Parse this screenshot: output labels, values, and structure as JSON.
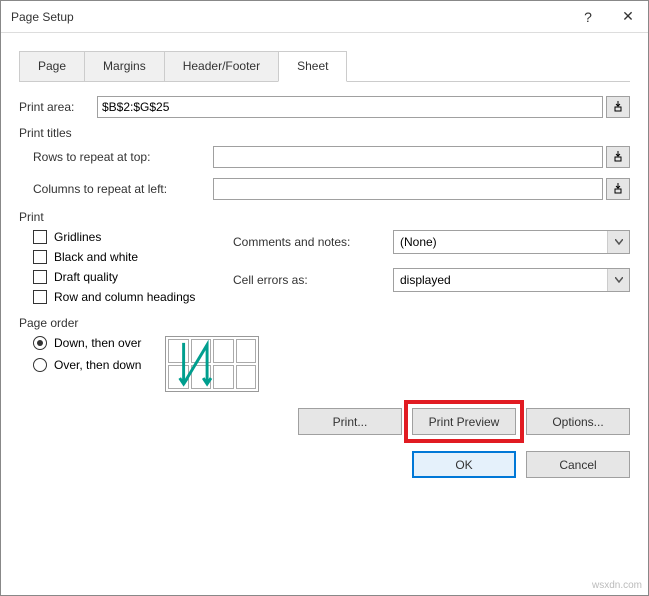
{
  "titlebar": {
    "title": "Page Setup",
    "help": "?",
    "close": "✕"
  },
  "tabs": {
    "page": "Page",
    "margins": "Margins",
    "header_footer": "Header/Footer",
    "sheet": "Sheet"
  },
  "print_area": {
    "label": "Print area:",
    "value": "$B$2:$G$25"
  },
  "print_titles": {
    "label": "Print titles",
    "rows_label": "Rows to repeat at top:",
    "rows_value": "",
    "cols_label": "Columns to repeat at left:",
    "cols_value": ""
  },
  "print_section": {
    "label": "Print",
    "gridlines": "Gridlines",
    "bw": "Black and white",
    "draft": "Draft quality",
    "rowcol": "Row and column headings",
    "comments_label": "Comments and notes:",
    "comments_value": "(None)",
    "errors_label": "Cell errors as:",
    "errors_value": "displayed"
  },
  "page_order": {
    "label": "Page order",
    "down_over": "Down, then over",
    "over_down": "Over, then down"
  },
  "buttons": {
    "print": "Print...",
    "preview": "Print Preview",
    "options": "Options...",
    "ok": "OK",
    "cancel": "Cancel"
  },
  "watermark": "wsxdn.com"
}
